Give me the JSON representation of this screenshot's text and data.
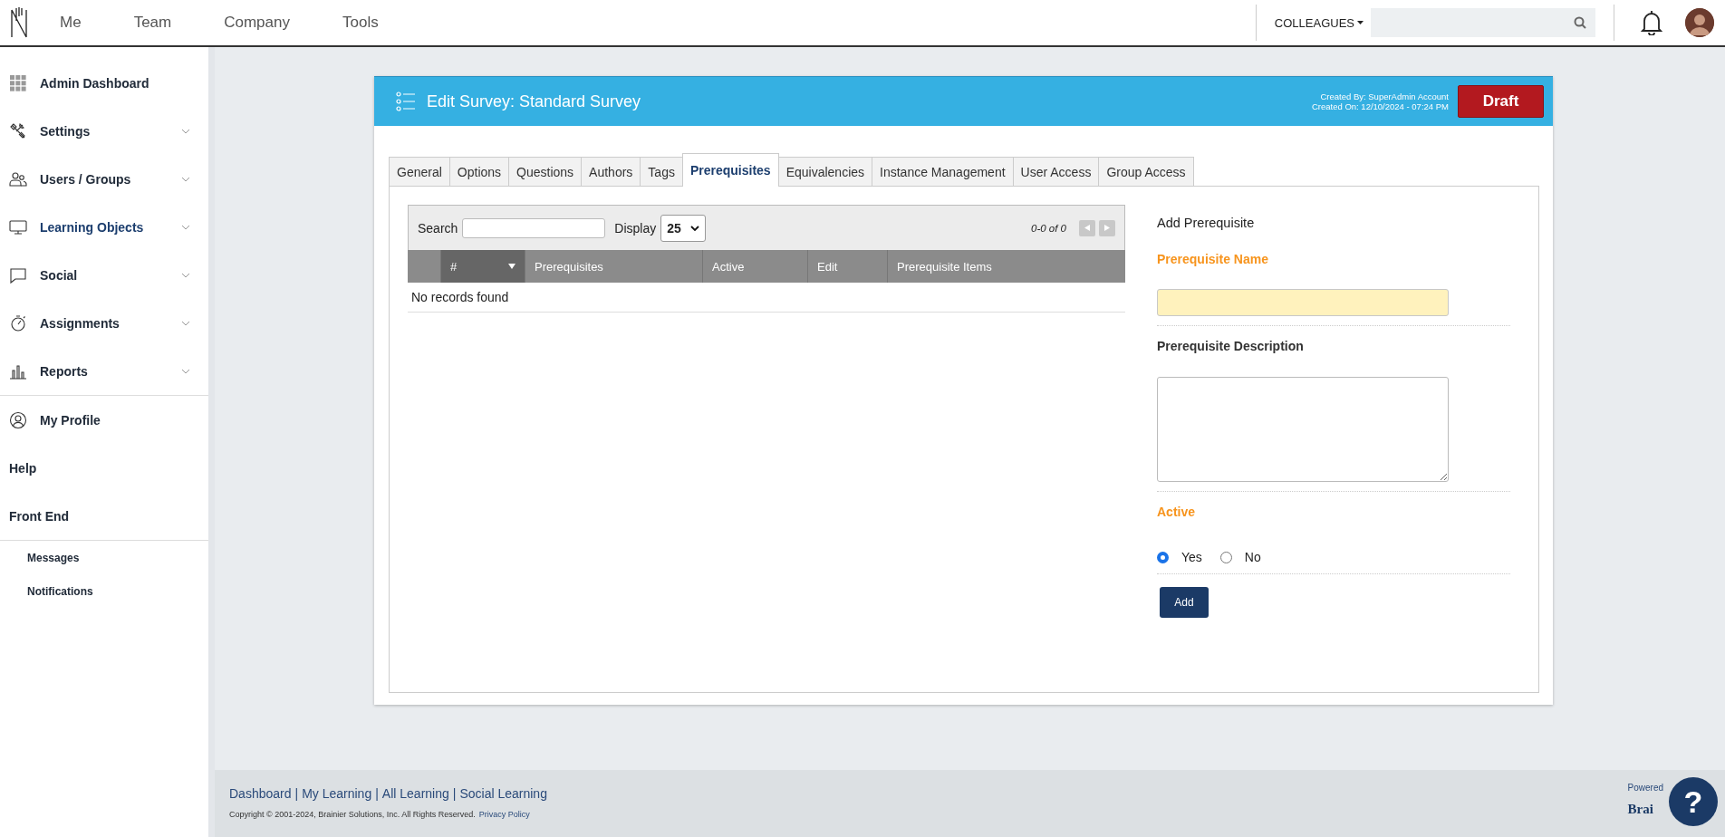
{
  "top_nav": {
    "items": [
      {
        "label": "Me"
      },
      {
        "label": "Team"
      },
      {
        "label": "Company"
      },
      {
        "label": "Tools"
      }
    ],
    "colleagues_menu": "COLLEAGUES"
  },
  "sidebar": {
    "sections": [
      {
        "items": [
          {
            "label": "Admin Dashboard",
            "kind": "grid",
            "expandable": false,
            "selected": false
          },
          {
            "label": "Settings",
            "kind": "tools",
            "expandable": true,
            "selected": false
          },
          {
            "label": "Users / Groups",
            "kind": "users",
            "expandable": true,
            "selected": false
          },
          {
            "label": "Learning Objects",
            "kind": "monitor",
            "expandable": true,
            "selected": true
          },
          {
            "label": "Social",
            "kind": "chat",
            "expandable": true,
            "selected": false
          },
          {
            "label": "Assignments",
            "kind": "stopwatch",
            "expandable": true,
            "selected": false
          },
          {
            "label": "Reports",
            "kind": "chart",
            "expandable": true,
            "selected": false
          }
        ]
      },
      {
        "items": [
          {
            "label": "My Profile",
            "kind": "profile",
            "expandable": false,
            "selected": false
          },
          {
            "label": "Help",
            "kind": "plain",
            "expandable": false,
            "selected": false
          },
          {
            "label": "Front End",
            "kind": "plain",
            "expandable": false,
            "selected": false
          }
        ]
      },
      {
        "items": [
          {
            "label": "Messages",
            "kind": "sub",
            "expandable": false,
            "selected": false
          },
          {
            "label": "Notifications",
            "kind": "sub",
            "expandable": false,
            "selected": false
          }
        ]
      }
    ]
  },
  "survey": {
    "title": "Edit Survey: Standard Survey",
    "created_by": "Created By: SuperAdmin Account",
    "created_on": "Created On: 12/10/2024 - 07:24 PM",
    "status": "Draft",
    "tabs": [
      {
        "label": "General",
        "selected": false
      },
      {
        "label": "Options",
        "selected": false
      },
      {
        "label": "Questions",
        "selected": false
      },
      {
        "label": "Authors",
        "selected": false
      },
      {
        "label": "Tags",
        "selected": false
      },
      {
        "label": "Prerequisites",
        "selected": true
      },
      {
        "label": "Equivalencies",
        "selected": false
      },
      {
        "label": "Instance Management",
        "selected": false
      },
      {
        "label": "User Access",
        "selected": false
      },
      {
        "label": "Group Access",
        "selected": false
      }
    ],
    "table": {
      "search_label": "Search",
      "display_label": "Display",
      "display_value": "25",
      "paging": "0-0 of 0",
      "columns": [
        {
          "label": "#",
          "sorted": true
        },
        {
          "label": "Prerequisites",
          "sorted": false
        },
        {
          "label": "Active",
          "sorted": false
        },
        {
          "label": "Edit",
          "sorted": false
        },
        {
          "label": "Prerequisite Items",
          "sorted": false
        }
      ],
      "empty_message": "No records found"
    },
    "form": {
      "heading": "Add Prerequisite",
      "name_label": "Prerequisite Name",
      "description_label": "Prerequisite Description",
      "active_label": "Active",
      "active_options": [
        {
          "label": "Yes",
          "selected": true
        },
        {
          "label": "No",
          "selected": false
        }
      ],
      "submit": "Add"
    }
  },
  "footer": {
    "links": [
      "Dashboard",
      "My Learning",
      "All Learning",
      "Social Learning"
    ],
    "link_separators": [
      "|",
      "|",
      "|"
    ],
    "copyright": "Copyright © 2001-2024, Brainier Solutions, Inc. All Rights Reserved.",
    "privacy_link": "Privacy Policy",
    "powered": "Powered",
    "brand": "Brai",
    "help": "?"
  }
}
